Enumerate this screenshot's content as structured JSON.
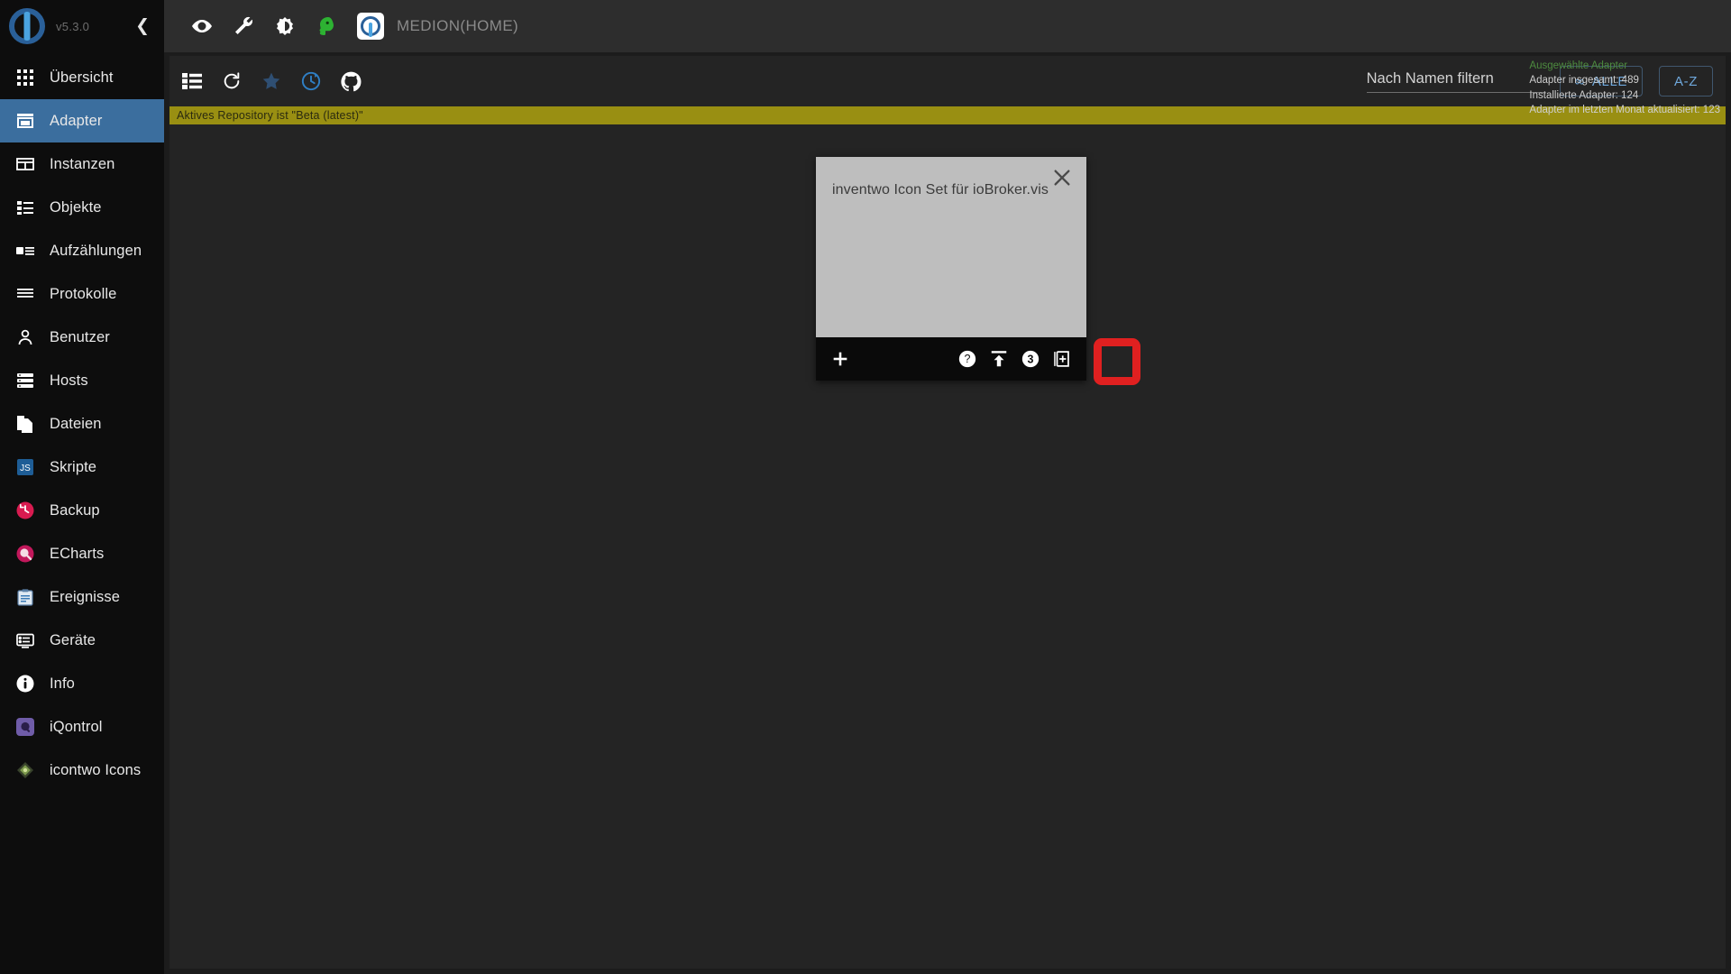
{
  "sidebar": {
    "version": "v5.3.0",
    "collapse_icon": "chevron-left-icon",
    "items": [
      {
        "label": "Übersicht",
        "icon": "grid-icon",
        "active": false
      },
      {
        "label": "Adapter",
        "icon": "store-icon",
        "active": true
      },
      {
        "label": "Instanzen",
        "icon": "instances-icon",
        "active": false
      },
      {
        "label": "Objekte",
        "icon": "list-icon",
        "active": false
      },
      {
        "label": "Aufzählungen",
        "icon": "enums-icon",
        "active": false
      },
      {
        "label": "Protokolle",
        "icon": "logs-icon",
        "active": false
      },
      {
        "label": "Benutzer",
        "icon": "user-icon",
        "active": false
      },
      {
        "label": "Hosts",
        "icon": "hosts-icon",
        "active": false
      },
      {
        "label": "Dateien",
        "icon": "files-icon",
        "active": false
      },
      {
        "label": "Skripte",
        "icon": "javascript-icon",
        "active": false
      },
      {
        "label": "Backup",
        "icon": "backup-icon",
        "active": false
      },
      {
        "label": "ECharts",
        "icon": "echarts-icon",
        "active": false
      },
      {
        "label": "Ereignisse",
        "icon": "events-icon",
        "active": false
      },
      {
        "label": "Geräte",
        "icon": "devices-icon",
        "active": false
      },
      {
        "label": "Info",
        "icon": "info-icon",
        "active": false
      },
      {
        "label": "iQontrol",
        "icon": "iqontrol-icon",
        "active": false
      },
      {
        "label": "icontwo Icons",
        "icon": "icontwo-icon",
        "active": false
      }
    ]
  },
  "topbar": {
    "icons": [
      "eye-icon",
      "wrench-icon",
      "brightness-icon",
      "head-icon"
    ],
    "host_icon": "iobroker-logo-icon",
    "host_name": "MEDION(HOME)"
  },
  "toolbar": {
    "icons": [
      "list-view-icon",
      "refresh-icon",
      "star-icon",
      "update-history-icon",
      "github-icon"
    ],
    "filter": {
      "value": "",
      "placeholder": "Nach Namen filtern"
    },
    "all_button": {
      "label": "ALLE",
      "icon": "infinity-icon"
    },
    "sort_button": {
      "label": "A-Z"
    }
  },
  "stats": {
    "title": "Ausgewählte Adapter",
    "lines": [
      "Adapter insgesamt: 489",
      "Installierte Adapter: 124",
      "Adapter im letzten Monat aktualisiert: 123"
    ]
  },
  "repo_banner": {
    "text": "Aktives Repository ist \"Beta (latest)\""
  },
  "card": {
    "title": "inventwo Icon Set für ioBroker.vis",
    "close_icon": "close-icon",
    "footer": {
      "add_icon": "plus-icon",
      "help_icon": "question-circle-icon",
      "upload_icon": "upload-icon",
      "version_badge": "3",
      "install_icon": "add-instance-icon"
    },
    "highlight_color": "#e02020"
  },
  "colors": {
    "accent": "#3b6e9e",
    "sidebar_bg": "#0d0d0d",
    "panel_bg": "#242424",
    "banner": "#998f12",
    "link": "#6fa8dc",
    "stats_title": "#4d8b3f"
  }
}
